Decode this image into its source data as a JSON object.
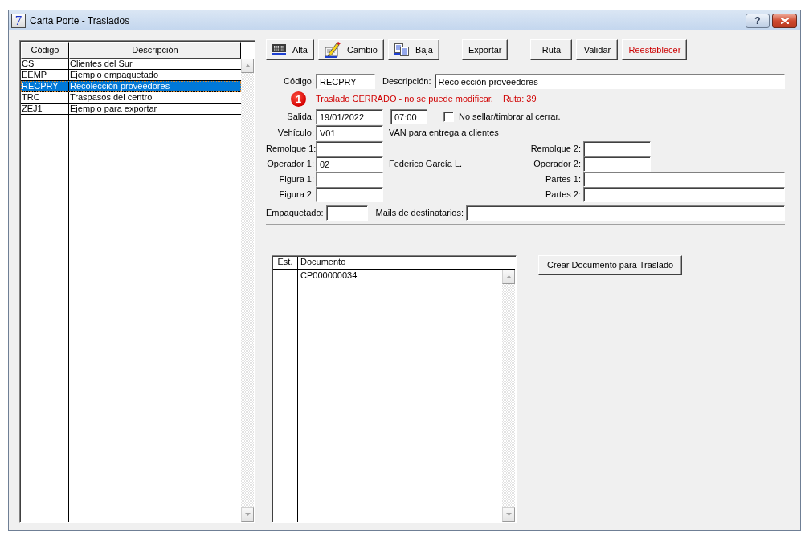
{
  "window": {
    "title": "Carta Porte - Traslados",
    "icon_text": "7",
    "help_button": "?"
  },
  "code_list": {
    "columns": [
      "Código",
      "Descripción"
    ],
    "rows": [
      {
        "code": "CS",
        "description": "Clientes del Sur",
        "selected": false
      },
      {
        "code": "EEMP",
        "description": "Ejemplo empaquetado",
        "selected": false
      },
      {
        "code": "RECPRY",
        "description": "Recolección proveedores",
        "selected": true
      },
      {
        "code": "TRC",
        "description": "Traspasos del centro",
        "selected": false
      },
      {
        "code": "ZEJ1",
        "description": "Ejemplo para exportar",
        "selected": false
      }
    ]
  },
  "toolbar": [
    {
      "buttons": [
        {
          "label": "Alta",
          "kind": "default"
        },
        {
          "label": "Cambio",
          "kind": "default"
        },
        {
          "label": "Baja",
          "kind": "default"
        }
      ]
    },
    {
      "buttons": [
        {
          "label": "Exportar",
          "kind": "default"
        }
      ]
    },
    {
      "buttons": [
        {
          "label": "Ruta",
          "kind": "default"
        },
        {
          "label": "Validar",
          "kind": "default"
        },
        {
          "label": "Reestablecer",
          "kind": "warning"
        }
      ]
    }
  ],
  "header_fields": {
    "code": {
      "label": "Código:",
      "value": "RECPRY"
    },
    "description": {
      "label": "Descripción:",
      "value": "Recolección proveedores"
    }
  },
  "status": {
    "badge": "1",
    "message": "Traslado CERRADO - no se puede modificar.",
    "route": "Ruta: 39"
  },
  "departure": {
    "label": "Salida:",
    "date": "19/01/2022",
    "time": "07:00"
  },
  "no_stamp_checkbox": {
    "label": "No sellar/timbrar al cerrar.",
    "checked": false
  },
  "detail_rows": [
    {
      "left": {
        "label": "Vehículo:",
        "value": "V01",
        "note": "VAN para entrega a clientes"
      }
    },
    {
      "left": {
        "label": "Remolque 1:"
      },
      "right": {
        "label": "Remolque 2:",
        "kind": "code"
      }
    },
    {
      "left": {
        "label": "Operador 1:",
        "value": "02",
        "note": "Federico García L."
      },
      "right": {
        "label": "Operador 2:",
        "kind": "code"
      }
    },
    {
      "left": {
        "label": "Figura 1:"
      },
      "right": {
        "label": "Partes 1:",
        "kind": "text"
      }
    },
    {
      "left": {
        "label": "Figura 2:"
      },
      "right": {
        "label": "Partes 2:",
        "kind": "text"
      }
    }
  ],
  "packaging": {
    "label": "Empaquetado:"
  },
  "recipient_emails": {
    "label": "Mails de destinatarios:"
  },
  "documents": {
    "columns": [
      "Est.",
      "Documento"
    ],
    "rows": [
      {
        "document": "CP000000034",
        "selected": false
      }
    ]
  },
  "create_document_button": "Crear Documento para Traslado"
}
